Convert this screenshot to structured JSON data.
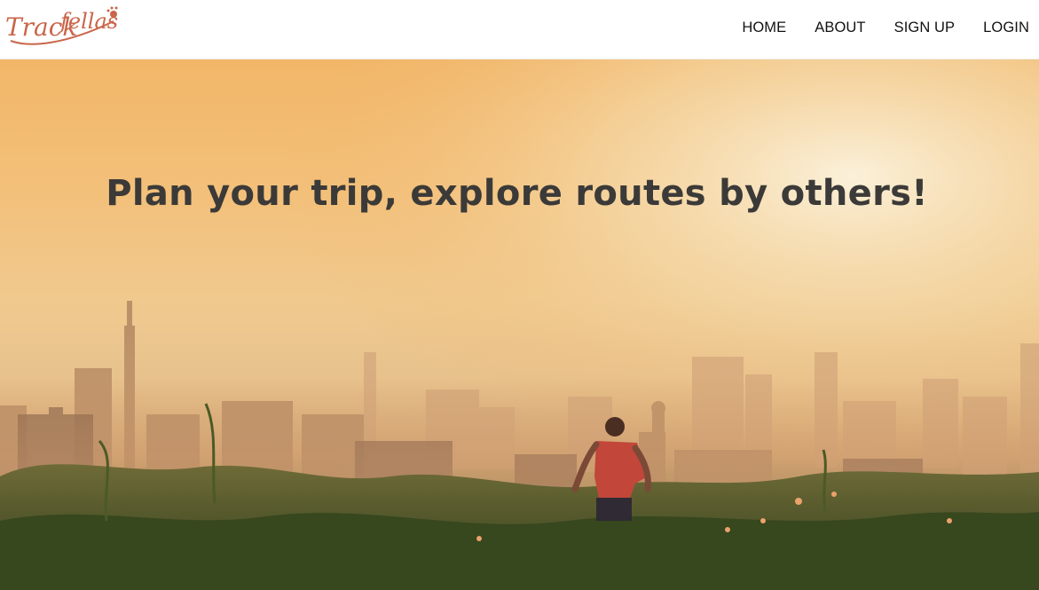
{
  "brand": {
    "logo_text": "Trackfellas",
    "logo_color": "#c9664a"
  },
  "nav": {
    "items": [
      {
        "label": "HOME"
      },
      {
        "label": "ABOUT"
      },
      {
        "label": "SIGN UP"
      },
      {
        "label": "LOGIN"
      }
    ]
  },
  "hero": {
    "title": "Plan your trip, explore routes by others!",
    "image_description_icon": "city-skyline-runner-image"
  },
  "colors": {
    "title_text": "#3b3a38",
    "nav_text": "#111111",
    "sky_warm": "#f2b668"
  }
}
